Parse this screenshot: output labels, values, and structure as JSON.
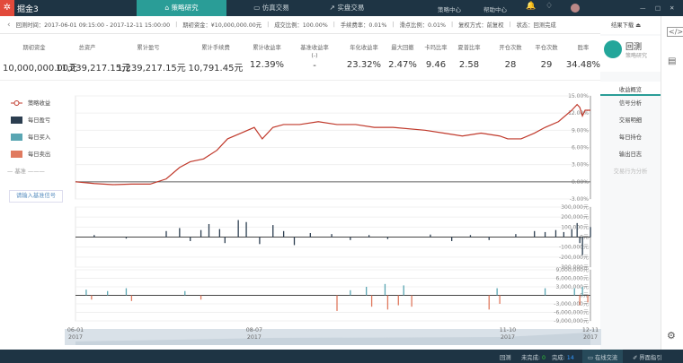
{
  "app": {
    "name": "掘金3",
    "logo_icon": "juejin-logo-icon"
  },
  "tabs": [
    {
      "label": "策略研究",
      "active": true
    },
    {
      "label": "仿真交易"
    },
    {
      "label": "实盘交易"
    }
  ],
  "top_links": [
    "策略中心",
    "帮助中心"
  ],
  "info": {
    "period": "回测时间：2017-06-01 09:15:00 - 2017-12-11 15:00:00",
    "capital": "期初资金：¥10,000,000.00元",
    "ratio": "成交比例：100.00%",
    "fee": "手续费率：0.01%",
    "slippage": "滑点比例：0.01%",
    "adjust": "复权方式：前复权",
    "state": "状态：回测完成",
    "download": "结果下载"
  },
  "stats": [
    {
      "label": "期初资金",
      "value": "10,000,000.00元"
    },
    {
      "label": "总资产",
      "value": "11,239,217.15元"
    },
    {
      "label": "累计盈亏",
      "value": "1,239,217.15元"
    },
    {
      "label": "累计手续费",
      "value": "10,791.45元"
    },
    {
      "label": "累计收益率",
      "value": "12.39%"
    },
    {
      "label": "基准收益率",
      "sub": "(-)",
      "value": "-"
    },
    {
      "label": "年化收益率",
      "value": "23.32%"
    },
    {
      "label": "最大回撤",
      "value": "2.47%"
    },
    {
      "label": "卡玛比率",
      "value": "9.46"
    },
    {
      "label": "夏普比率",
      "value": "2.58"
    },
    {
      "label": "开仓次数",
      "value": "28"
    },
    {
      "label": "平仓次数",
      "value": "29"
    },
    {
      "label": "胜率",
      "value": "34.48%"
    }
  ],
  "right_panel": {
    "title": "回测",
    "subtitle": "策略研究",
    "items": [
      "收益概览",
      "信号分析",
      "交易明细",
      "每日持仓",
      "输出日志",
      "交易行为分析"
    ],
    "active": "收益概览"
  },
  "legend": {
    "items": [
      "策略收益",
      "每日盈亏",
      "每日买入",
      "每日卖出"
    ],
    "benchmark_title": "基准",
    "benchmark_input": "请输入基准信号"
  },
  "colors": {
    "line": "#c0392b",
    "pnl": "#2c3e50",
    "buy": "#5aa6b3",
    "sell": "#e07a5f",
    "accent": "#2a9d97"
  },
  "chart_data": {
    "type": "line",
    "x_ticks": [
      {
        "date": "06-01",
        "year": "2017"
      },
      {
        "date": "08-07",
        "year": "2017"
      },
      {
        "date": "11-10",
        "year": "2017"
      },
      {
        "date": "12-11",
        "year": "2017"
      }
    ],
    "returns": {
      "name": "策略收益",
      "ylim": [
        -3,
        15
      ],
      "ticks": [
        "15.00%",
        "12.00%",
        "9.00%",
        "6.00%",
        "3.00%",
        "0.00%",
        "-3.00%"
      ],
      "dates": [
        "06-01",
        "06-08",
        "06-15",
        "06-22",
        "06-29",
        "07-05",
        "07-10",
        "07-14",
        "07-19",
        "07-24",
        "07-28",
        "08-02",
        "08-07",
        "08-10",
        "08-14",
        "08-18",
        "08-24",
        "08-31",
        "09-07",
        "09-14",
        "09-21",
        "09-28",
        "10-10",
        "10-17",
        "10-24",
        "10-31",
        "11-07",
        "11-10",
        "11-15",
        "11-20",
        "11-24",
        "11-29",
        "12-04",
        "12-06",
        "12-07",
        "12-08",
        "12-09",
        "12-11"
      ],
      "values": [
        0,
        -0.3,
        -0.5,
        -0.4,
        -0.4,
        0.5,
        2.5,
        3.5,
        4,
        5.5,
        7.5,
        8.5,
        9.5,
        7.5,
        9.5,
        10,
        10,
        10.5,
        10,
        10,
        9.5,
        9.5,
        9,
        8.5,
        8,
        8.5,
        8,
        7.5,
        7.5,
        8.5,
        9.5,
        10.5,
        12.5,
        13.5,
        13,
        11.5,
        12.5,
        12.5
      ]
    },
    "daily_pnl": {
      "name": "每日盈亏",
      "ylim": [
        -300000,
        300000
      ],
      "ticks": [
        "300,000元",
        "200,000元",
        "100,000元",
        "0元",
        "-100,000元",
        "-200,000元",
        "-300,000元"
      ],
      "dates": [
        "06-08",
        "06-20",
        "07-05",
        "07-10",
        "07-14",
        "07-18",
        "07-21",
        "07-25",
        "07-27",
        "08-01",
        "08-04",
        "08-09",
        "08-14",
        "08-18",
        "08-22",
        "08-28",
        "09-05",
        "09-12",
        "09-19",
        "09-26",
        "10-12",
        "10-20",
        "10-27",
        "11-03",
        "11-13",
        "11-20",
        "11-24",
        "11-28",
        "12-01",
        "12-04",
        "12-06",
        "12-07",
        "12-08",
        "12-11"
      ],
      "values": [
        20000,
        -15000,
        60000,
        90000,
        -40000,
        70000,
        130000,
        80000,
        -60000,
        170000,
        150000,
        -70000,
        120000,
        60000,
        -80000,
        40000,
        30000,
        -30000,
        20000,
        -20000,
        25000,
        -40000,
        20000,
        -30000,
        30000,
        60000,
        50000,
        70000,
        50000,
        80000,
        140000,
        -60000,
        -180000,
        100000
      ]
    },
    "daily_trades": {
      "ylim": [
        -9000000,
        9000000
      ],
      "ticks": [
        "9,000,000元",
        "6,000,000元",
        "3,000,000元",
        "0元",
        "-3,000,000元",
        "-6,000,000元",
        "-9,000,000元"
      ],
      "buy": {
        "name": "每日买入",
        "dates": [
          "06-05",
          "06-13",
          "06-20",
          "07-12",
          "09-12",
          "09-18",
          "09-25",
          "10-02",
          "11-06",
          "11-24",
          "12-05",
          "12-08"
        ],
        "values": [
          2000000,
          1500000,
          2500000,
          1500000,
          1800000,
          3000000,
          4000000,
          3500000,
          2500000,
          2500000,
          2500000,
          3000000
        ]
      },
      "sell": {
        "name": "每日卖出",
        "dates": [
          "06-07",
          "06-22",
          "07-18",
          "09-07",
          "09-20",
          "09-26",
          "09-30",
          "10-05",
          "11-03",
          "11-07",
          "12-07",
          "12-10"
        ],
        "values": [
          -1500000,
          -2000000,
          -1500000,
          -5500000,
          -4000000,
          -5000000,
          -3500000,
          -4000000,
          -5000000,
          -3000000,
          -3500000,
          -2500000
        ]
      }
    }
  },
  "status": {
    "mode": "回测",
    "pending_label": "未完成:",
    "pending": "0",
    "done_label": "完成:",
    "done": "14",
    "chat": "在线交流",
    "guide": "界面指引"
  }
}
